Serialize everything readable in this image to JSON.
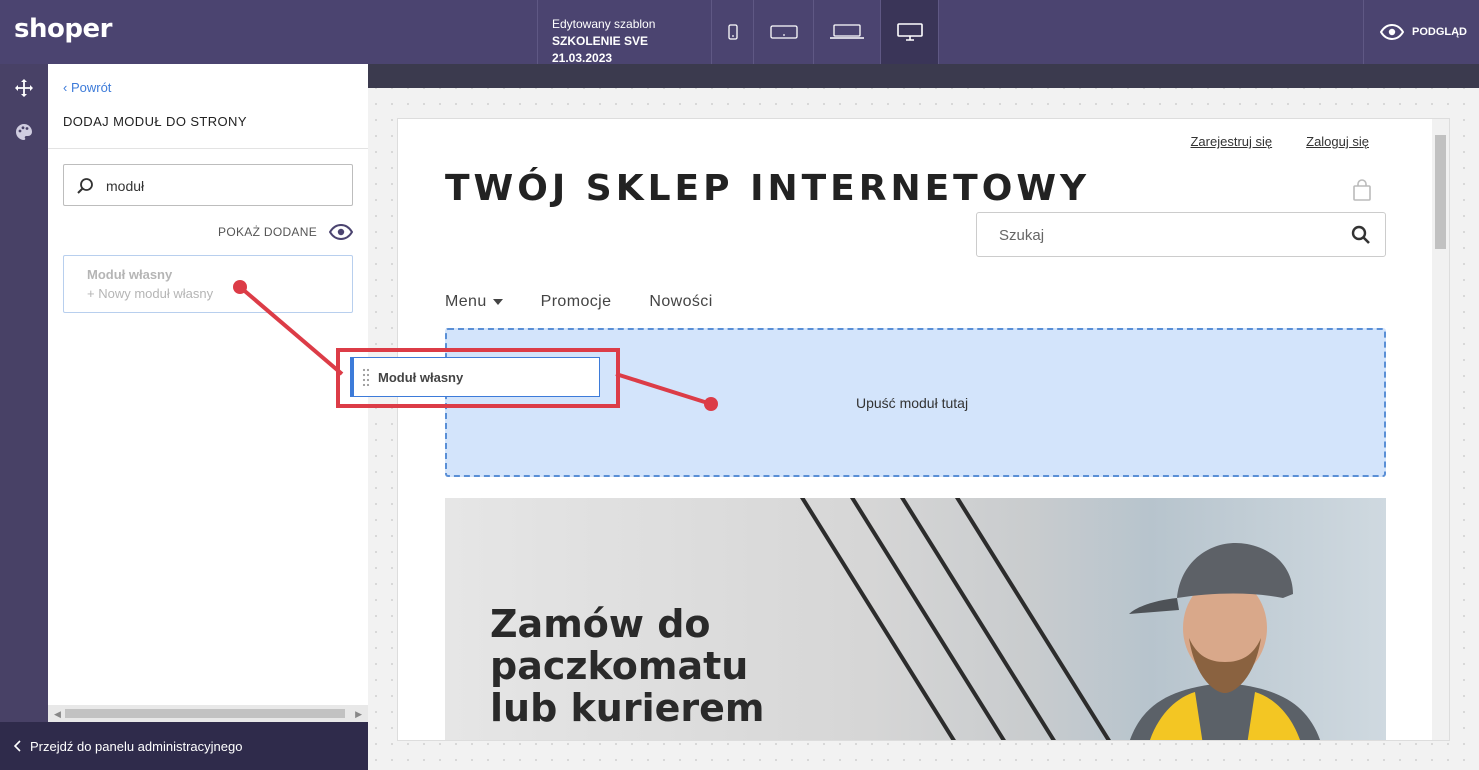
{
  "app": {
    "logo": "shoper",
    "accent": "#4b4470"
  },
  "topbar": {
    "template_caption": "Edytowany szablon",
    "template_name": "SZKOLENIE SVE 21.03.2023",
    "devices": [
      "phone-icon",
      "tablet-icon",
      "laptop-icon",
      "desktop-icon"
    ],
    "active_device": "desktop-icon",
    "preview_label": "PODGLĄD"
  },
  "panel": {
    "back_label": "Powrót",
    "title": "DODAJ MODUŁ DO STRONY",
    "search_value": "moduł",
    "show_added_label": "POKAŻ DODANE",
    "card": {
      "title": "Moduł własny",
      "subtitle": "+ Nowy moduł własny"
    },
    "admin_link": "Przejdź do panelu administracyjnego"
  },
  "drag": {
    "label": "Moduł własny"
  },
  "shop": {
    "register": "Zarejestruj się",
    "login": "Zaloguj się",
    "title": "TWÓJ SKLEP INTERNETOWY",
    "search_placeholder": "Szukaj",
    "nav": [
      "Menu",
      "Promocje",
      "Nowości"
    ],
    "dropzone_label": "Upuść moduł tutaj",
    "banner_heading": [
      "Zamów do",
      "paczkomatu",
      "lub kurierem"
    ]
  },
  "colors": {
    "annotation": "#dc3c47",
    "dropzone": "#d3e4fb",
    "link": "#3d7bd9"
  }
}
